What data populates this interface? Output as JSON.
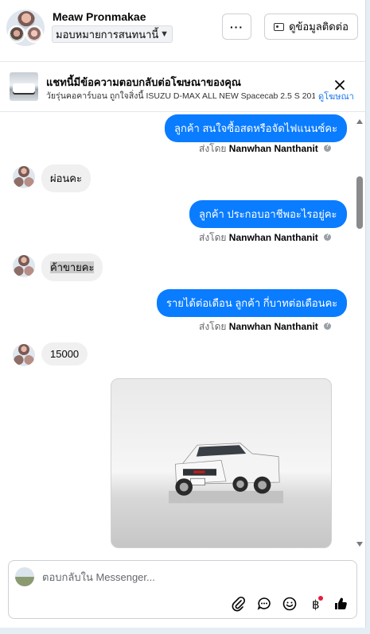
{
  "header": {
    "contact_name": "Meaw Pronmakae",
    "assign_label": "มอบหมายการสนทนานี้",
    "more_label": "···",
    "contact_info_label": "ดูข้อมูลติดต่อ"
  },
  "ad_banner": {
    "title": "แชทนี้มีข้อความตอบกลับต่อโฆษณาของคุณ",
    "subtitle": "วัยรุ่นคอคาร์บอน ถูกใจสิ่งนี้ ISUZU D-MAX ALL NEW Spacecab 2.5 S 201...",
    "link_label": "ดูโฆษณา"
  },
  "messages": [
    {
      "direction": "out",
      "text": "ลูกค้า สนใจซื้อสดหรือจัดไฟแนนซ์คะ",
      "sent_by_prefix": "ส่งโดย",
      "sent_by_name": "Nanwhan Nanthanit"
    },
    {
      "direction": "in",
      "text": "ผ่อนคะ"
    },
    {
      "direction": "out",
      "text": "ลูกค้า ประกอบอาชีพอะไรอยู่คะ",
      "sent_by_prefix": "ส่งโดย",
      "sent_by_name": "Nanwhan Nanthanit"
    },
    {
      "direction": "in",
      "text": "ค้าขายคะ"
    },
    {
      "direction": "out",
      "text": "รายได้ต่อเดือน ลูกค้า กี่บาทต่อเดือนคะ",
      "sent_by_prefix": "ส่งโดย",
      "sent_by_name": "Nanwhan Nanthanit"
    },
    {
      "direction": "in",
      "text": "15000"
    },
    {
      "direction": "in",
      "type": "image",
      "image_name": "isuzu-dmax-white-pickup-photo"
    }
  ],
  "composer": {
    "placeholder": "ตอบกลับใน Messenger..."
  },
  "colors": {
    "outgoing_bubble": "#0a7cff",
    "incoming_bubble": "#f0f0f0",
    "link": "#1877f2",
    "badge": "#e41e3f"
  },
  "icons": [
    "more-icon",
    "contact-card-icon",
    "close-icon",
    "attachment-icon",
    "saved-reply-icon",
    "emoji-icon",
    "baht-payment-icon",
    "like-icon",
    "info-icon",
    "caret-down-icon"
  ]
}
